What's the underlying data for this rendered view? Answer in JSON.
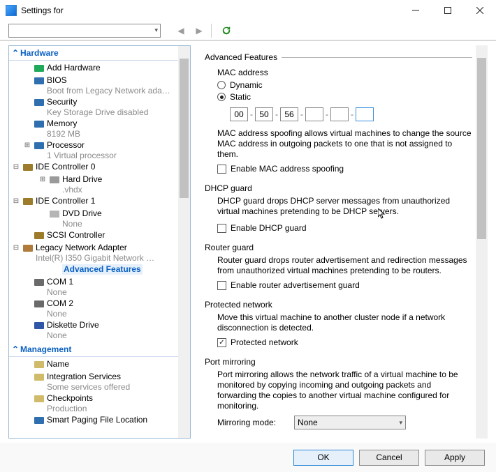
{
  "window": {
    "title": "Settings for"
  },
  "sidebar": {
    "sections": {
      "hardware": "Hardware",
      "management": "Management"
    },
    "nodes": [
      {
        "id": "add-hardware",
        "icon": "#1faa5b",
        "label": "Add Hardware",
        "sub": "",
        "indent": 1,
        "exp": ""
      },
      {
        "id": "bios",
        "icon": "#2f6fb0",
        "label": "BIOS",
        "sub": "Boot from Legacy Network ada…",
        "indent": 1,
        "exp": ""
      },
      {
        "id": "security",
        "icon": "#2f6fb0",
        "label": "Security",
        "sub": "Key Storage Drive disabled",
        "indent": 1,
        "exp": ""
      },
      {
        "id": "memory",
        "icon": "#2f6fb0",
        "label": "Memory",
        "sub": "8192 MB",
        "indent": 1,
        "exp": ""
      },
      {
        "id": "processor",
        "icon": "#2f6fb0",
        "label": "Processor",
        "sub": "1 Virtual processor",
        "indent": 1,
        "exp": "+"
      },
      {
        "id": "ide0",
        "icon": "#9c7b2a",
        "label": "IDE Controller 0",
        "sub": "",
        "indent": 0,
        "exp": "-"
      },
      {
        "id": "harddrive",
        "icon": "#9a9a9a",
        "label": "Hard Drive",
        "sub": ".vhdx",
        "indent": 2,
        "exp": "+"
      },
      {
        "id": "ide1",
        "icon": "#9c7b2a",
        "label": "IDE Controller 1",
        "sub": "",
        "indent": 0,
        "exp": "-"
      },
      {
        "id": "dvd",
        "icon": "#b5b5b5",
        "label": "DVD Drive",
        "sub": "None",
        "indent": 2,
        "exp": ""
      },
      {
        "id": "scsi",
        "icon": "#9c7b2a",
        "label": "SCSI Controller",
        "sub": "",
        "indent": 1,
        "exp": ""
      },
      {
        "id": "legacy-net",
        "icon": "#b07a3a",
        "label": "Legacy Network Adapter",
        "sub": "Intel(R) I350 Gigabit Network …",
        "indent": 0,
        "exp": "-"
      },
      {
        "id": "adv-feat",
        "icon": "",
        "label": "Advanced Features",
        "sub": "",
        "indent": 2,
        "exp": "",
        "selected": true
      },
      {
        "id": "com1",
        "icon": "#6a6a6a",
        "label": "COM 1",
        "sub": "None",
        "indent": 1,
        "exp": ""
      },
      {
        "id": "com2",
        "icon": "#6a6a6a",
        "label": "COM 2",
        "sub": "None",
        "indent": 1,
        "exp": ""
      },
      {
        "id": "diskette",
        "icon": "#3056a8",
        "label": "Diskette Drive",
        "sub": "None",
        "indent": 1,
        "exp": ""
      }
    ],
    "mgmt_nodes": [
      {
        "id": "name",
        "icon": "#d0bb6a",
        "label": "Name",
        "sub": "",
        "indent": 1,
        "exp": ""
      },
      {
        "id": "integration",
        "icon": "#d0bb6a",
        "label": "Integration Services",
        "sub": "Some services offered",
        "indent": 1,
        "exp": ""
      },
      {
        "id": "checkpoints",
        "icon": "#d0bb6a",
        "label": "Checkpoints",
        "sub": "Production",
        "indent": 1,
        "exp": ""
      },
      {
        "id": "smartpaging",
        "icon": "#2f6fb0",
        "label": "Smart Paging File Location",
        "sub": "",
        "indent": 1,
        "exp": ""
      }
    ]
  },
  "main": {
    "advanced_features": "Advanced Features",
    "mac": {
      "label": "MAC address",
      "dynamic": "Dynamic",
      "static": "Static",
      "static_selected": true,
      "octets": [
        "00",
        "50",
        "56",
        "",
        "",
        ""
      ],
      "spoof_desc": "MAC address spoofing allows virtual machines to change the source MAC address in outgoing packets to one that is not assigned to them.",
      "spoof_check": "Enable MAC address spoofing"
    },
    "dhcp": {
      "label": "DHCP guard",
      "desc": "DHCP guard drops DHCP server messages from unauthorized virtual machines pretending to be DHCP servers.",
      "check": "Enable DHCP guard"
    },
    "router": {
      "label": "Router guard",
      "desc": "Router guard drops router advertisement and redirection messages from unauthorized virtual machines pretending to be routers.",
      "check": "Enable router advertisement guard"
    },
    "protected": {
      "label": "Protected network",
      "desc": "Move this virtual machine to another cluster node if a network disconnection is detected.",
      "check": "Protected network",
      "checked": true
    },
    "mirror": {
      "label": "Port mirroring",
      "desc": "Port mirroring allows the network traffic of a virtual machine to be monitored by copying incoming and outgoing packets and forwarding the copies to another virtual machine configured for monitoring.",
      "mode_label": "Mirroring mode:",
      "mode_value": "None"
    }
  },
  "buttons": {
    "ok": "OK",
    "cancel": "Cancel",
    "apply": "Apply"
  }
}
